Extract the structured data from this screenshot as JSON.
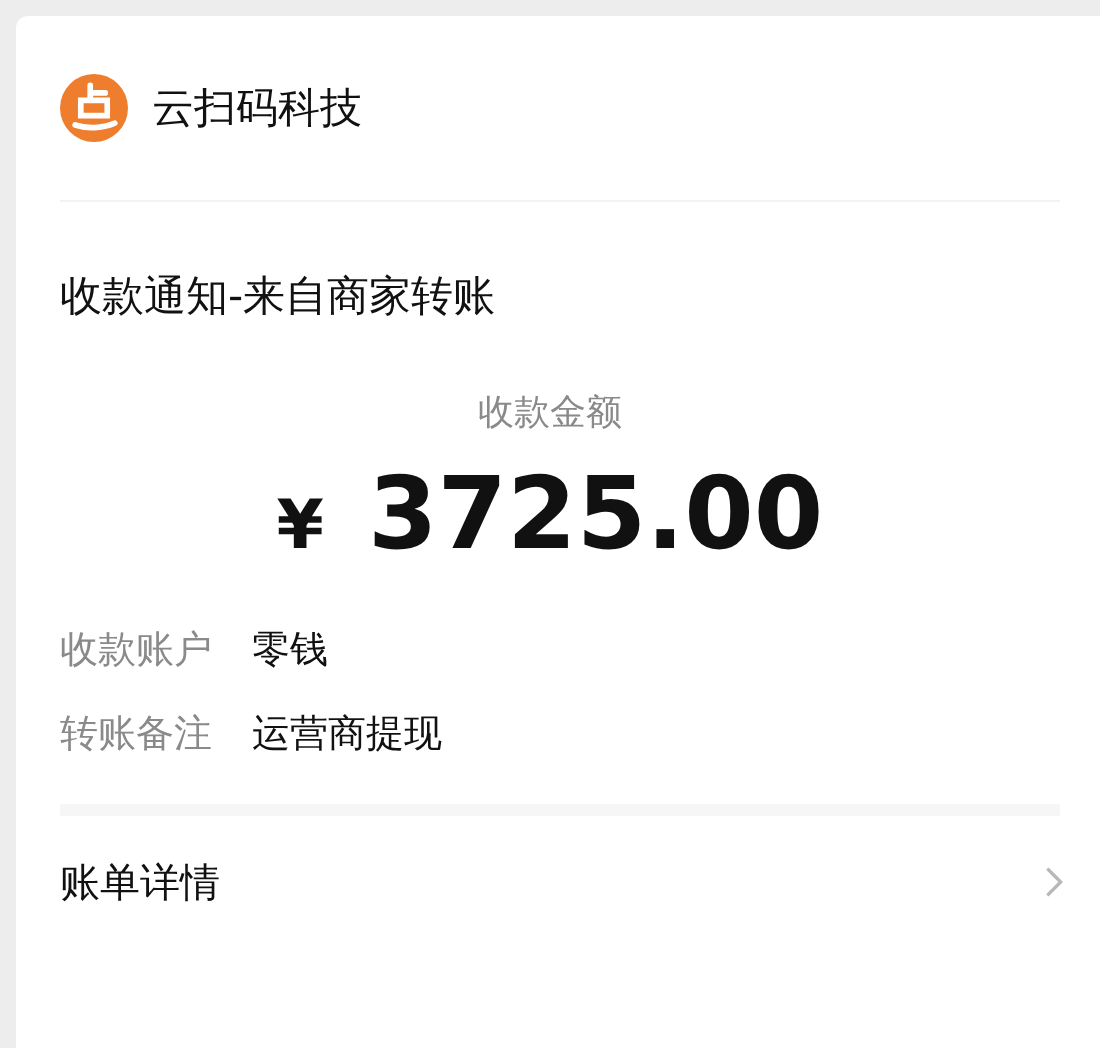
{
  "merchant": {
    "name": "云扫码科技"
  },
  "title": "收款通知-来自商家转账",
  "amount": {
    "label": "收款金额",
    "currency": "¥",
    "value": "3725.00"
  },
  "details": [
    {
      "label": "收款账户",
      "value": "零钱"
    },
    {
      "label": "转账备注",
      "value": "运营商提现"
    }
  ],
  "footer": {
    "label": "账单详情"
  }
}
